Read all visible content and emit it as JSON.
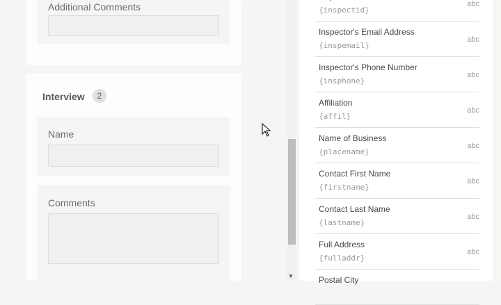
{
  "form": {
    "card1": {
      "field_label": "Additional Comments"
    },
    "interview": {
      "title": "Interview",
      "count": "2",
      "fields": [
        {
          "label": "Name"
        },
        {
          "label": "Comments"
        }
      ]
    }
  },
  "field_list": [
    {
      "title": "Inspector ID",
      "code": "{inspectid}",
      "type": "abc"
    },
    {
      "title": "Inspector's Email Address",
      "code": "{inspemail}",
      "type": "abc"
    },
    {
      "title": "Inspector's Phone Number",
      "code": "{insphone}",
      "type": "abc"
    },
    {
      "title": "Affiliation",
      "code": "{affil}",
      "type": "abc"
    },
    {
      "title": "Name of Business",
      "code": "{placename}",
      "type": "abc"
    },
    {
      "title": "Contact First Name",
      "code": "{firstname}",
      "type": "abc"
    },
    {
      "title": "Contact Last Name",
      "code": "{lastname}",
      "type": "abc"
    },
    {
      "title": "Full Address",
      "code": "{fulladdr}",
      "type": "abc"
    },
    {
      "title": "Postal City",
      "code": "",
      "type": ""
    }
  ]
}
